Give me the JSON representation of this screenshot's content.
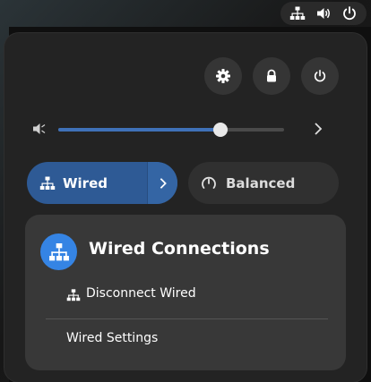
{
  "colors": {
    "accent": "#3584e4",
    "toggle_active": "#2e5a95",
    "panel_bg": "#232323",
    "submenu_bg": "#383838"
  },
  "topbar": {
    "icons": [
      "network-wired-icon",
      "speaker-volume-icon",
      "power-icon"
    ]
  },
  "quick_settings": {
    "buttons": [
      "settings-icon",
      "lock-icon",
      "power-icon"
    ],
    "volume": {
      "icon": "speaker-volume-low-icon",
      "level": 0.72,
      "expand_icon": "chevron-right-icon"
    },
    "toggles": {
      "wired": {
        "label": "Wired",
        "icon": "network-wired-icon",
        "active": true
      },
      "balanced": {
        "label": "Balanced",
        "icon": "power-profile-balanced-icon",
        "active": false
      }
    }
  },
  "wired_menu": {
    "title": "Wired Connections",
    "items": [
      {
        "label": "Disconnect Wired",
        "icon": "network-wired-icon"
      },
      {
        "label": "Wired Settings"
      }
    ]
  }
}
